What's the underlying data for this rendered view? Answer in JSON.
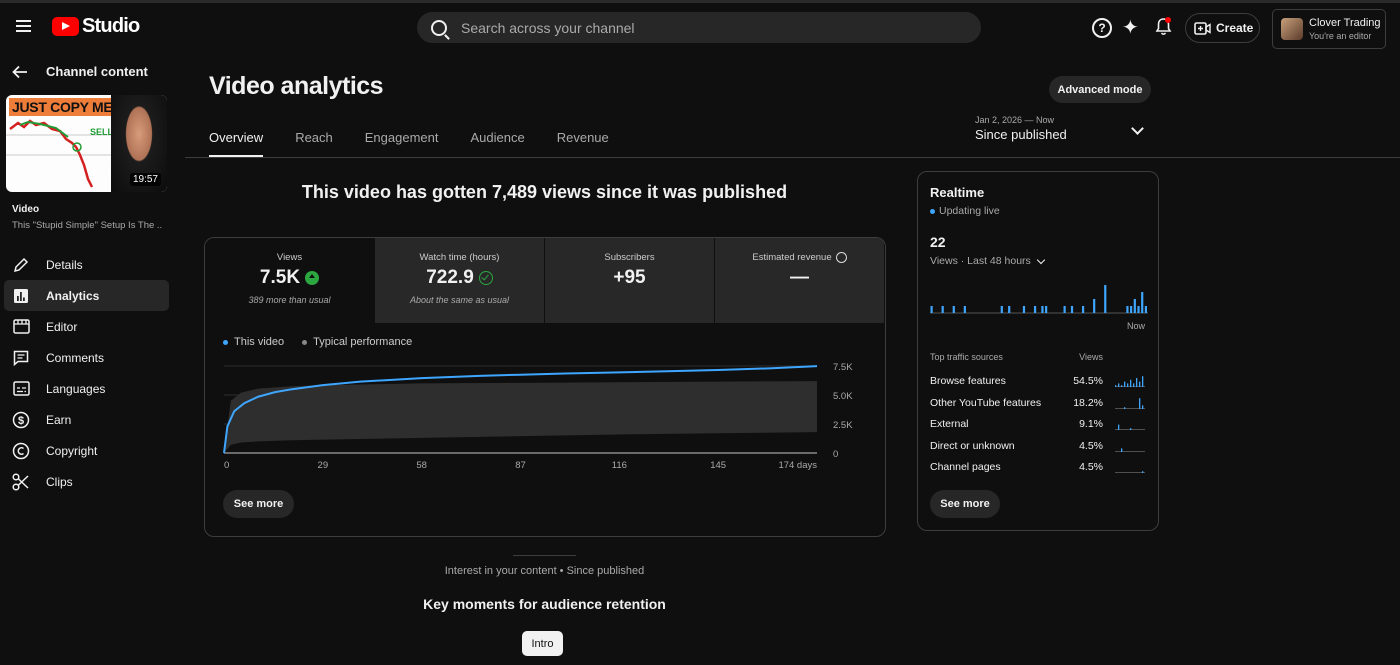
{
  "header": {
    "logo_text": "Studio",
    "search_placeholder": "Search across your channel",
    "create_label": "Create",
    "account_name": "Clover Trading",
    "account_role": "You're an editor"
  },
  "sidebar": {
    "back_label": "Channel content",
    "thumbnail": {
      "overlay_text": "JUST COPY ME",
      "sell_text": "SELL",
      "duration": "19:57"
    },
    "video_label": "Video",
    "video_title": "This \"Stupid Simple\" Setup Is The ...",
    "items": [
      {
        "label": "Details",
        "icon": "pencil-icon",
        "active": false
      },
      {
        "label": "Analytics",
        "icon": "analytics-icon",
        "active": true
      },
      {
        "label": "Editor",
        "icon": "editor-icon",
        "active": false
      },
      {
        "label": "Comments",
        "icon": "comments-icon",
        "active": false
      },
      {
        "label": "Languages",
        "icon": "languages-icon",
        "active": false
      },
      {
        "label": "Earn",
        "icon": "earn-icon",
        "active": false
      },
      {
        "label": "Copyright",
        "icon": "copyright-icon",
        "active": false
      },
      {
        "label": "Clips",
        "icon": "scissors-icon",
        "active": false
      }
    ]
  },
  "main": {
    "title": "Video analytics",
    "advanced_mode": "Advanced mode",
    "tabs": [
      "Overview",
      "Reach",
      "Engagement",
      "Audience",
      "Revenue"
    ],
    "active_tab": "Overview",
    "date_small": "Jan 2, 2026 — Now",
    "date_big": "Since published",
    "headline": "This video has gotten 7,489 views since it was published",
    "metrics": [
      {
        "label": "Views",
        "value": "7.5K",
        "note": "389 more than usual"
      },
      {
        "label": "Watch time (hours)",
        "value": "722.9",
        "note": "About the same as usual"
      },
      {
        "label": "Subscribers",
        "value": "+95",
        "note": ""
      },
      {
        "label": "Estimated revenue",
        "value": "—",
        "note": ""
      }
    ],
    "legend": {
      "this_video": "This video",
      "typical": "Typical performance"
    },
    "see_more": "See more",
    "interest": "Interest in your content • Since published",
    "key_moments": "Key moments for audience retention",
    "intro": "Intro"
  },
  "chart_data": {
    "type": "line",
    "x_ticks": [
      "0",
      "29",
      "58",
      "87",
      "116",
      "145",
      "174 days"
    ],
    "y_ticks": [
      "7.5K",
      "5.0K",
      "2.5K",
      "0"
    ],
    "ylim": [
      0,
      7500
    ],
    "xlim": [
      0,
      174
    ],
    "series": [
      {
        "name": "This video",
        "color": "#3ea6ff",
        "x": [
          0,
          1,
          3,
          6,
          10,
          15,
          20,
          29,
          40,
          58,
          75,
          87,
          100,
          116,
          130,
          145,
          160,
          174
        ],
        "y": [
          0,
          2300,
          3600,
          4300,
          4850,
          5250,
          5500,
          5850,
          6150,
          6450,
          6650,
          6750,
          6850,
          6950,
          7050,
          7150,
          7300,
          7489
        ]
      },
      {
        "name": "Typical performance",
        "color": "#3a3a3a",
        "x": [
          0,
          2,
          5,
          10,
          20,
          29,
          58,
          87,
          116,
          145,
          174
        ],
        "lower": [
          0,
          700,
          900,
          1000,
          1100,
          1150,
          1300,
          1450,
          1600,
          1700,
          1800
        ],
        "upper": [
          0,
          4500,
          5200,
          5550,
          5750,
          5850,
          6000,
          6050,
          6100,
          6150,
          6200
        ]
      }
    ]
  },
  "realtime": {
    "title": "Realtime",
    "status": "Updating live",
    "count": "22",
    "range": "Views · Last 48 hours",
    "now": "Now",
    "bars": [
      1,
      0,
      0,
      1,
      0,
      0,
      1,
      0,
      0,
      1,
      0,
      0,
      0,
      0,
      0,
      0,
      0,
      0,
      0,
      1,
      0,
      1,
      0,
      0,
      0,
      1,
      0,
      0,
      1,
      0,
      1,
      1,
      0,
      0,
      0,
      0,
      1,
      0,
      1,
      0,
      0,
      1,
      0,
      0,
      2,
      0,
      0,
      4,
      0,
      0,
      0,
      0,
      0,
      1,
      1,
      2,
      1,
      3,
      1
    ],
    "sources_header": "Top traffic sources",
    "views_header": "Views",
    "sources": [
      {
        "name": "Browse features",
        "pct": "54.5%"
      },
      {
        "name": "Other YouTube features",
        "pct": "18.2%"
      },
      {
        "name": "External",
        "pct": "9.1%"
      },
      {
        "name": "Direct or unknown",
        "pct": "4.5%"
      },
      {
        "name": "Channel pages",
        "pct": "4.5%"
      }
    ],
    "see_more": "See more"
  },
  "colors": {
    "accent": "#3ea6ff",
    "positive": "#2ba640",
    "brand": "#ff0000",
    "bg": "#0f0f0f"
  }
}
